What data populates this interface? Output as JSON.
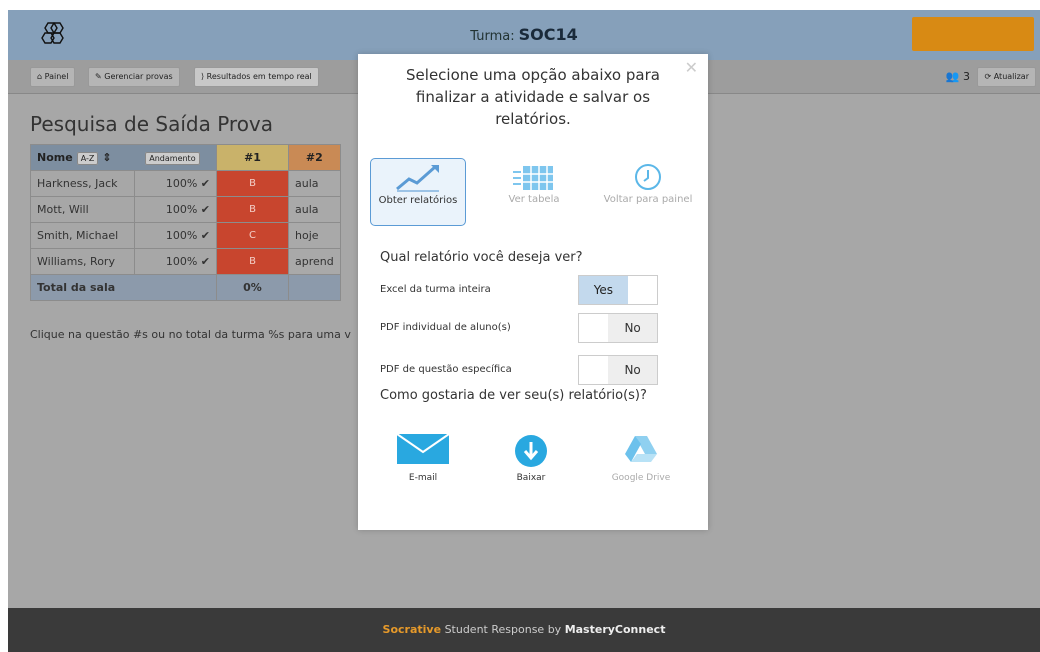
{
  "header": {
    "turma_label": "Turma:",
    "turma_code": "SOC14"
  },
  "nav": {
    "painel": "Painel",
    "gerenciar": "Gerenciar provas",
    "resultados": "Resultados em tempo real",
    "count": "3",
    "atualizar": "Atualizar"
  },
  "page": {
    "title": "Pesquisa de Saída Prova"
  },
  "table": {
    "name_header": "Nome",
    "sort_name": "A-Z",
    "sort_progress": "Andamento",
    "q_headers": [
      "#1",
      "#2"
    ],
    "rows": [
      {
        "name": "Harkness, Jack",
        "pct": "100%",
        "grade": "B",
        "answer": "aula"
      },
      {
        "name": "Mott, Will",
        "pct": "100%",
        "grade": "B",
        "answer": "aula"
      },
      {
        "name": "Smith, Michael",
        "pct": "100%",
        "grade": "C",
        "answer": "hoje"
      },
      {
        "name": "Williams, Rory",
        "pct": "100%",
        "grade": "B",
        "answer": "aprend"
      }
    ],
    "total_label": "Total da sala",
    "total_pct": "0%"
  },
  "hint": {
    "text": "Clique na questão #s ou no total da turma %s para uma v"
  },
  "modal": {
    "title": "Selecione uma opção abaixo para finalizar a atividade e salvar os relatórios.",
    "options": [
      {
        "label": "Obter relatórios"
      },
      {
        "label": "Ver tabela"
      },
      {
        "label": "Voltar para painel"
      }
    ],
    "report_question": "Qual relatório você deseja ver?",
    "toggles": [
      {
        "label": "Excel da turma inteira",
        "value": "Yes",
        "on": true
      },
      {
        "label": "PDF individual de aluno(s)",
        "value": "No",
        "on": false
      },
      {
        "label": "PDF de questão específica",
        "value": "No",
        "on": false
      }
    ],
    "share_question": "Como gostaria de ver seu(s) relatório(s)?",
    "share": [
      {
        "label": "E-mail"
      },
      {
        "label": "Baixar"
      },
      {
        "label": "Google Drive"
      }
    ]
  },
  "footer": {
    "brand": "Socrative",
    "middle": "Student Response by",
    "company": "MasteryConnect"
  },
  "colors": {
    "accent": "#5b9bd5",
    "orange": "#d88a14",
    "grade_red": "#c8452e"
  }
}
